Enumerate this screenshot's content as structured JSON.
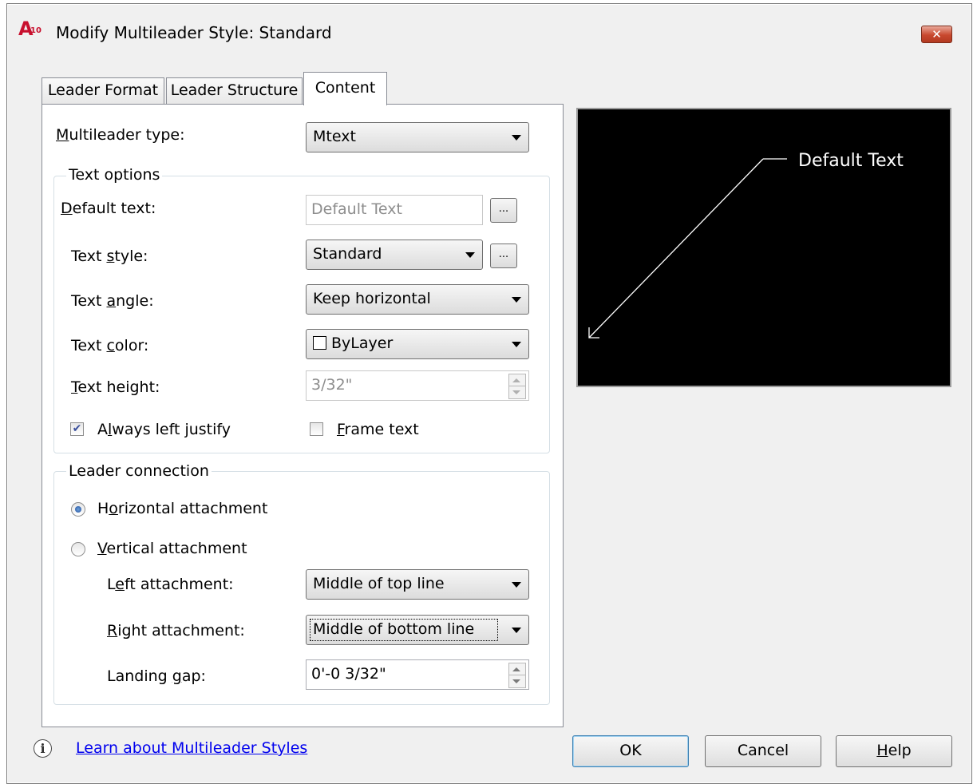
{
  "window": {
    "title": "Modify Multileader Style: Standard",
    "app_icon_letter": "A",
    "app_icon_version": "10",
    "close_glyph": "✕"
  },
  "tabs": [
    {
      "label": "Leader Format",
      "active": false
    },
    {
      "label": "Leader Structure",
      "active": false
    },
    {
      "label": "Content",
      "active": true
    }
  ],
  "content": {
    "multileader_type": {
      "label_u": "M",
      "label_rest": "ultileader type:",
      "value": "Mtext"
    },
    "text_options": {
      "legend": "Text options",
      "default_text": {
        "label_u": "D",
        "label_rest": "efault text:",
        "value": "Default Text",
        "button": "..."
      },
      "text_style": {
        "label_pre": "Text ",
        "label_u": "s",
        "label_rest": "tyle:",
        "value": "Standard",
        "button": "..."
      },
      "text_angle": {
        "label_pre": "Text ",
        "label_u": "a",
        "label_rest": "ngle:",
        "value": "Keep horizontal"
      },
      "text_color": {
        "label_pre": "Text ",
        "label_u": "c",
        "label_rest": "olor:",
        "value": "ByLayer"
      },
      "text_height": {
        "label_u": "T",
        "label_rest": "ext height:",
        "value": "3/32\""
      },
      "always_left_justify": {
        "label_pre": "A",
        "label_u": "l",
        "label_rest": "ways left justify",
        "checked": true
      },
      "frame_text": {
        "label_u": "F",
        "label_rest": "rame text",
        "checked": false
      }
    },
    "leader_connection": {
      "legend": "Leader connection",
      "horizontal_attachment": {
        "label_pre": "H",
        "label_u": "o",
        "label_rest": "rizontal attachment",
        "selected": true
      },
      "vertical_attachment": {
        "label_u": "V",
        "label_rest": "ertical attachment",
        "selected": false
      },
      "left_attachment": {
        "label_pre": "L",
        "label_u": "e",
        "label_rest": "ft attachment:",
        "value": "Middle of top line"
      },
      "right_attachment": {
        "label_u": "R",
        "label_rest": "ight attachment:",
        "value": "Middle of bottom line"
      },
      "landing_gap": {
        "label_pre": "Landing ",
        "label_u": "g",
        "label_rest": "ap:",
        "value": "0'-0 3/32\""
      }
    }
  },
  "preview": {
    "sample_text": "Default Text",
    "background": "#000000",
    "line_color": "#ffffff"
  },
  "footer": {
    "info_glyph": "i",
    "learn_link": "Learn about Multileader Styles",
    "ok_label": "OK",
    "cancel_label": "Cancel",
    "help_u": "H",
    "help_rest": "elp"
  },
  "colors": {
    "link": "#0000ee",
    "close_button": "#c8482e",
    "dialog_bg": "#f0f0f0"
  }
}
